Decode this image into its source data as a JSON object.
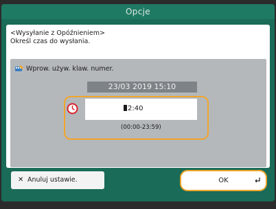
{
  "window": {
    "title": "Opcje"
  },
  "header": {
    "line1": "<Wysyłanie z Opóźnieniem>",
    "line2": "Określ czas do wysłania."
  },
  "hint": {
    "text": "Wprow. używ. klaw. numer."
  },
  "datetime": {
    "value": "23/03 2019 15:10"
  },
  "time_input": {
    "value": "2:40",
    "range": "(00:00-23:59)"
  },
  "buttons": {
    "cancel": "Anuluj ustawie.",
    "ok": "OK"
  },
  "icons": {
    "clock": "clock-icon",
    "hint": "keypad-hint-icon",
    "cancel": "close-icon",
    "ok": "enter-icon"
  },
  "colors": {
    "accent": "#f2a52a",
    "header_bg": "#1f7a64",
    "panel_bg": "#b4b8bb"
  }
}
